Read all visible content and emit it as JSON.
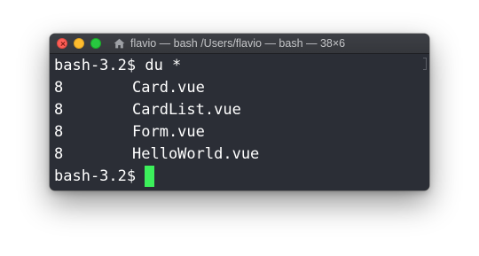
{
  "window": {
    "title": "flavio — bash /Users/flavio — bash — 38×6",
    "title_icon": "home-folder-icon"
  },
  "terminal": {
    "prompt_command": "bash-3.2$ du *",
    "rows": [
      {
        "size": "8",
        "name": "Card.vue"
      },
      {
        "size": "8",
        "name": "CardList.vue"
      },
      {
        "size": "8",
        "name": "Form.vue"
      },
      {
        "size": "8",
        "name": "HelloWorld.vue"
      }
    ],
    "prompt": "bash-3.2$ "
  },
  "colors": {
    "background": "#2b2e36",
    "text": "#ffffff",
    "cursor": "#3cf05b",
    "close": "#fd5f57",
    "minimize": "#febc2e",
    "maximize": "#28c840"
  }
}
